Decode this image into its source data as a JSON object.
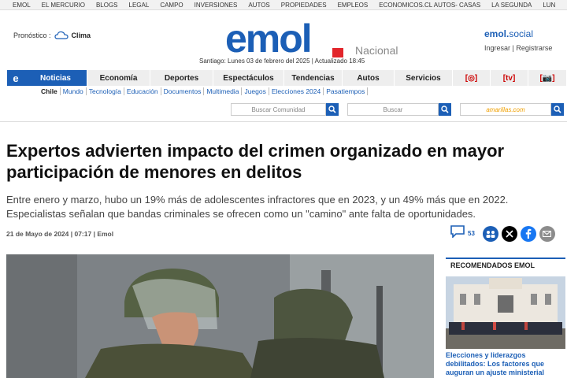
{
  "top_links": [
    "EMOL",
    "EL MERCURIO",
    "BLOGS",
    "LEGAL",
    "CAMPO",
    "INVERSIONES",
    "AUTOS",
    "PROPIEDADES",
    "EMPLEOS",
    "ECONOMICOS.CL AUTOS- CASAS",
    "LA SEGUNDA",
    "LUN"
  ],
  "weather": {
    "label": "Pronóstico :",
    "value": "Clima"
  },
  "logo": {
    "text": "emol",
    "section": "Nacional"
  },
  "date_line": "Santiago: Lunes 03 de febrero del 2025 | Actualizado 18:45",
  "social": {
    "brand_a": "emol.",
    "brand_b": "social",
    "login": "Ingresar",
    "register": "Registrarse"
  },
  "nav": {
    "logo_letter": "e",
    "items": [
      "Noticias",
      "Economía",
      "Deportes",
      "Espectáculos",
      "Tendencias",
      "Autos",
      "Servicios"
    ],
    "icons": [
      "[◎]",
      "[tv]",
      "[📷]"
    ]
  },
  "subnav": [
    "Chile",
    "Mundo",
    "Tecnología",
    "Educación",
    "Documentos",
    "Multimedia",
    "Juegos",
    "Elecciones 2024",
    "Pasatiempos"
  ],
  "search": {
    "community_placeholder": "Buscar Comunidad",
    "general_placeholder": "Buscar",
    "amarillas_placeholder": "amarillas.com"
  },
  "article": {
    "headline": "Expertos advierten impacto del crimen organizado en mayor participación de menores en delitos",
    "lead": "Entre enero y marzo, hubo un 19% más de adolescentes infractores que en 2023, y un 49% más que en 2022. Especialistas señalan que bandas criminales se ofrecen como un \"camino\" ante falta de oportunidades.",
    "meta": "21 de Mayo de 2024 | 07:17 | Emol",
    "comment_count": "53"
  },
  "sidebar": {
    "title": "RECOMENDADOS EMOL",
    "caption": "Elecciones y liderazgos debilitados: Los factores que auguran un ajuste ministerial"
  },
  "colors": {
    "brand_blue": "#1c5fb6",
    "brand_red": "#e2252b"
  }
}
